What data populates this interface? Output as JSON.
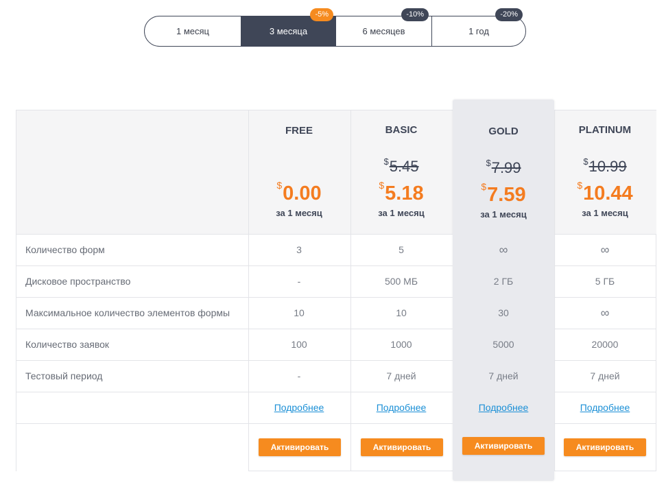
{
  "periods": [
    {
      "label": "1 месяц",
      "badge": ""
    },
    {
      "label": "3 месяца",
      "badge": "-5%"
    },
    {
      "label": "6 месяцев",
      "badge": "-10%"
    },
    {
      "label": "1 год",
      "badge": "-20%"
    }
  ],
  "active_period": "3 месяца",
  "currency": "$",
  "plans": [
    {
      "name": "FREE",
      "old_price": "",
      "price": "0.00",
      "per": "за 1 месяц"
    },
    {
      "name": "BASIC",
      "old_price": "5.45",
      "price": "5.18",
      "per": "за 1 месяц"
    },
    {
      "name": "GOLD",
      "old_price": "7.99",
      "price": "7.59",
      "per": "за 1 месяц"
    },
    {
      "name": "PLATINUM",
      "old_price": "10.99",
      "price": "10.44",
      "per": "за 1 месяц"
    }
  ],
  "rows": [
    {
      "label": "Количество форм",
      "values": [
        "3",
        "5",
        "∞",
        "∞"
      ]
    },
    {
      "label": "Дисковое пространство",
      "values": [
        "-",
        "500 МБ",
        "2 ГБ",
        "5 ГБ"
      ]
    },
    {
      "label": "Максимальное количество элементов формы",
      "values": [
        "10",
        "10",
        "30",
        "∞"
      ]
    },
    {
      "label": "Количество заявок",
      "values": [
        "100",
        "1000",
        "5000",
        "20000"
      ]
    },
    {
      "label": "Тестовый период",
      "values": [
        "-",
        "7 дней",
        "7 дней",
        "7 дней"
      ]
    }
  ],
  "more_label": "Подробнее",
  "activate_label": "Активировать",
  "colors": {
    "accent": "#f68b1f",
    "dark": "#3f4657",
    "link": "#1a8fd6",
    "highlight": "#e9eaee"
  }
}
